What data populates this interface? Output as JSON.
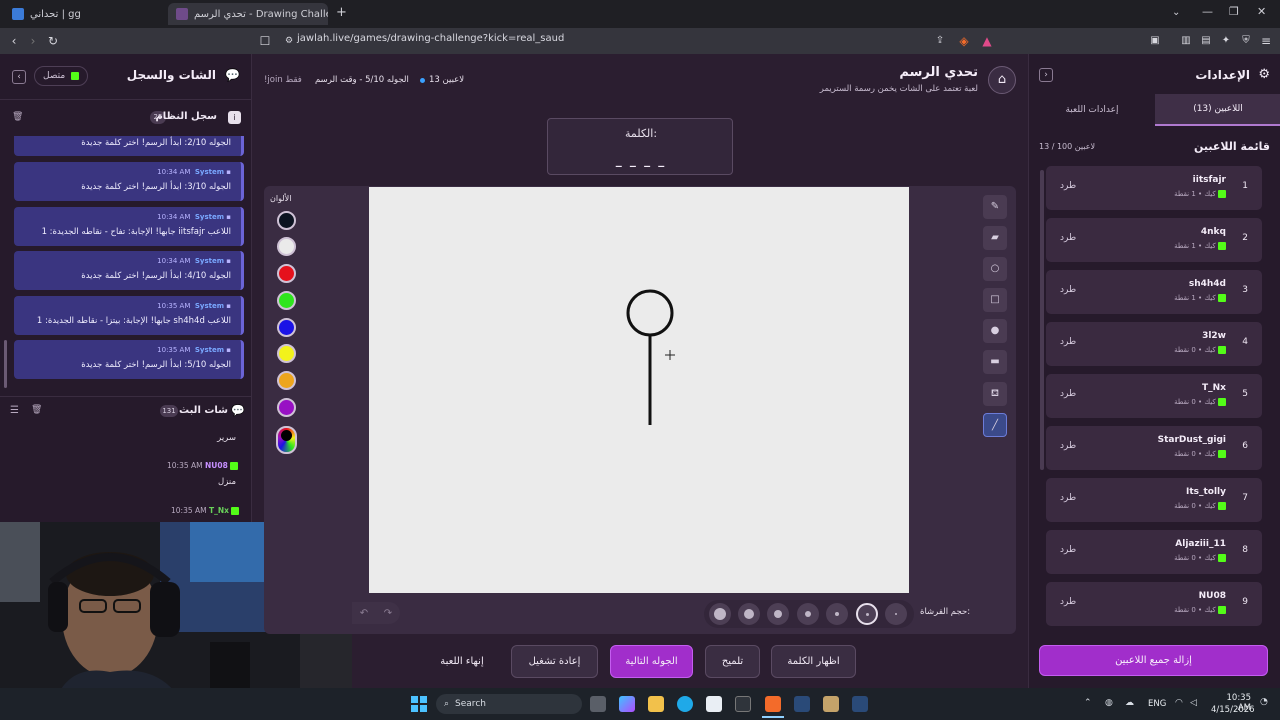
{
  "browser": {
    "tabs": [
      {
        "label": "تحداني | gg"
      },
      {
        "label": "تحدي الرسم - Drawing Challenge"
      }
    ],
    "new_tab": "+",
    "url": "jawlah.live/games/drawing-challenge?kick=real_saud"
  },
  "left_panel": {
    "title": "الشات والسجل",
    "status": "متصل",
    "system_log": {
      "title": "سجل النظام",
      "count": "25",
      "messages": [
        {
          "sender": "",
          "time": "",
          "text": "الجوله 2/10: ابدأ الرسم! اختر كلمة جديدة"
        },
        {
          "sender": "System",
          "time": "10:34 AM",
          "text": "الجوله 3/10: ابدأ الرسم! اختر كلمة جديدة"
        },
        {
          "sender": "System",
          "time": "10:34 AM",
          "text": "اللاعب iitsfajr جابها! الإجابة: تفاح - نقاطه الجديدة: 1"
        },
        {
          "sender": "System",
          "time": "10:34 AM",
          "text": "الجوله 4/10: ابدأ الرسم! اختر كلمة جديدة"
        },
        {
          "sender": "System",
          "time": "10:35 AM",
          "text": "اللاعب sh4h4d جابها! الإجابة: بيتزا - نقاطه الجديدة: 1"
        },
        {
          "sender": "System",
          "time": "10:35 AM",
          "text": "الجوله 5/10: ابدأ الرسم! اختر كلمة جديدة"
        }
      ]
    },
    "stream_chat": {
      "title": "شات البث",
      "count": "131",
      "messages": [
        {
          "user": "",
          "time": "",
          "text": "سرير"
        },
        {
          "user": "NU08",
          "time": "10:35 AM",
          "text": "منزل"
        },
        {
          "user": "T_Nx",
          "time": "10:35 AM",
          "text": ""
        }
      ]
    }
  },
  "header": {
    "title": "تحدي الرسم",
    "subtitle": "لعبة تعتمد على الشات يخمن رسمة الستريمر",
    "players_count": "13 لاعبين",
    "round": "الجوله 5/10 - وقت الرسم",
    "join_hint": "!join فقط"
  },
  "word": {
    "label": "الكلمة:",
    "mask": "_ _ _ _"
  },
  "board": {
    "colors_label": "الألوان",
    "colors": [
      "#0c1421",
      "#eaeaea",
      "#e5111c",
      "#2ee51d",
      "#1b12e6",
      "#f2f21b",
      "#eda51d",
      "#9810c4"
    ],
    "brush_size_label": "حجم الفرشاة:",
    "tools": [
      "pencil-icon",
      "eraser-icon",
      "circle-icon",
      "square-icon",
      "dot-icon",
      "rect-fill-icon",
      "fill-bucket-icon",
      "line-icon"
    ]
  },
  "controls": {
    "show_word": "اظهار الكلمة",
    "hint": "تلميح",
    "next_round": "الجوله التالية",
    "restart": "إعادة تشغيل",
    "end_game": "إنهاء اللعبة"
  },
  "right_panel": {
    "title": "الإعدادات",
    "tab_players": "اللاعبين (13)",
    "tab_game": "إعدادات اللعبة",
    "list_title": "قائمة اللاعبين",
    "list_count": "13 / 100 لاعبين",
    "kick_label": "طرد",
    "players": [
      {
        "rank": "1",
        "name": "iitsfajr",
        "sub": "كيك • 1 نقطة"
      },
      {
        "rank": "2",
        "name": "4nkq",
        "sub": "كيك • 1 نقطة"
      },
      {
        "rank": "3",
        "name": "sh4h4d",
        "sub": "كيك • 1 نقطة"
      },
      {
        "rank": "4",
        "name": "3l2w",
        "sub": "كيك • 0 نقطة"
      },
      {
        "rank": "5",
        "name": "T_Nx",
        "sub": "كيك • 0 نقطة"
      },
      {
        "rank": "6",
        "name": "StarDust_gigi",
        "sub": "كيك • 0 نقطة"
      },
      {
        "rank": "7",
        "name": "Its_tolly",
        "sub": "كيك • 0 نقطة"
      },
      {
        "rank": "8",
        "name": "Aljaziii_11",
        "sub": "كيك • 0 نقطة"
      },
      {
        "rank": "9",
        "name": "NU08",
        "sub": "كيك • 0 نقطة"
      }
    ],
    "remove_all": "إزالة جميع اللاعبين"
  },
  "taskbar": {
    "search": "Search",
    "lang": "ENG",
    "time": "10:35 AM",
    "date": "4/15/2026"
  }
}
